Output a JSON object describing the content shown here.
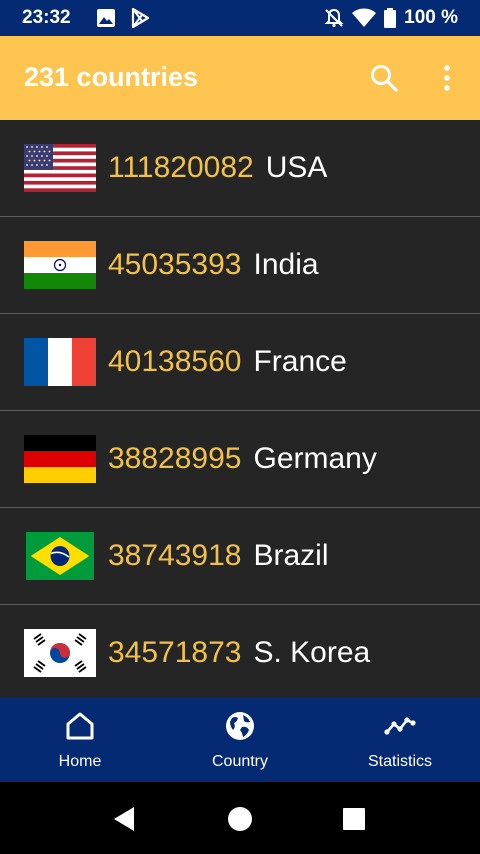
{
  "status_bar": {
    "time": "23:32",
    "left_icons": [
      "image-icon",
      "play-store-icon"
    ],
    "right_icons": [
      "mute-icon",
      "wifi-icon",
      "battery-icon"
    ],
    "battery": "100 %"
  },
  "app_bar": {
    "title": "231 countries",
    "actions": [
      "search-icon",
      "more-vert-icon"
    ],
    "background": "#fdc44f"
  },
  "countries": [
    {
      "count": "111820082",
      "name": "USA",
      "flag": "us-flag"
    },
    {
      "count": "45035393",
      "name": "India",
      "flag": "india-flag"
    },
    {
      "count": "40138560",
      "name": "France",
      "flag": "france-flag"
    },
    {
      "count": "38828995",
      "name": "Germany",
      "flag": "germany-flag"
    },
    {
      "count": "38743918",
      "name": "Brazil",
      "flag": "brazil-flag"
    },
    {
      "count": "34571873",
      "name": "S. Korea",
      "flag": "south-korea-flag"
    }
  ],
  "bottom_nav": {
    "items": [
      {
        "label": "Home",
        "icon": "home-icon"
      },
      {
        "label": "Country",
        "icon": "globe-icon"
      },
      {
        "label": "Statistics",
        "icon": "chart-line-icon"
      }
    ],
    "background": "#052a74"
  },
  "system_nav": {
    "buttons": [
      "back-icon",
      "home-circle-icon",
      "recents-icon"
    ]
  },
  "colors": {
    "count_text": "#f2c14a",
    "list_background": "#252525",
    "divider": "#5c5c5c"
  }
}
